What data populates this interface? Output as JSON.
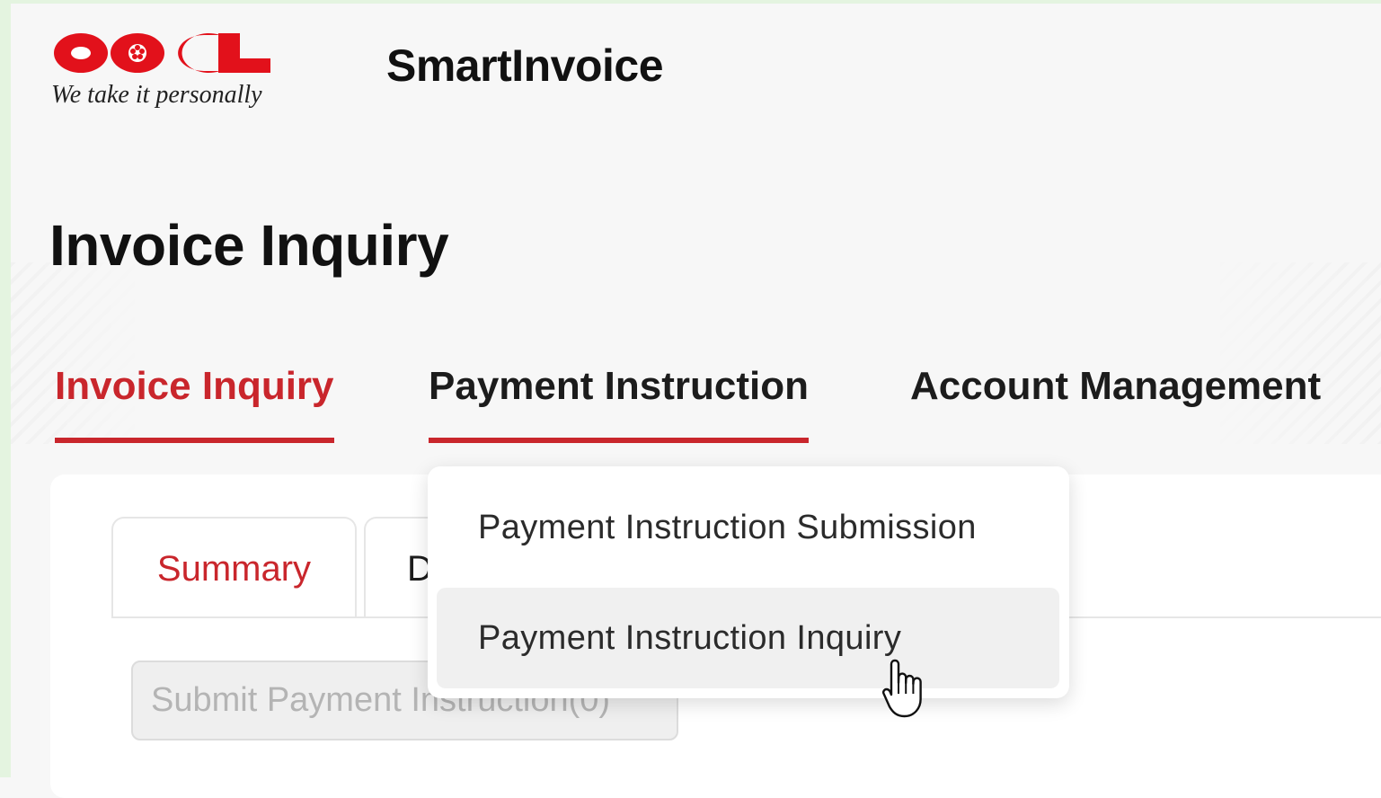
{
  "brand": {
    "logo_text": "OOCL",
    "tagline": "We take it personally",
    "app_name": "SmartInvoice",
    "brand_color": "#c9262c"
  },
  "page": {
    "title": "Invoice Inquiry"
  },
  "nav": {
    "items": [
      {
        "label": "Invoice Inquiry",
        "state": "active"
      },
      {
        "label": "Payment Instruction",
        "state": "hover"
      },
      {
        "label": "Account Management",
        "state": "default"
      }
    ]
  },
  "payment_menu": {
    "items": [
      {
        "label": "Payment Instruction Submission"
      },
      {
        "label": "Payment Instruction Inquiry",
        "highlighted": true
      }
    ]
  },
  "tabs": {
    "items": [
      {
        "label": "Summary",
        "active": true
      },
      {
        "label": "D",
        "active": false
      }
    ]
  },
  "actions": {
    "submit_label": "Submit Payment Instruction(0)"
  },
  "icons": {
    "cursor": "hand-pointer-icon",
    "logo_mark": "flower-emblem-icon"
  }
}
